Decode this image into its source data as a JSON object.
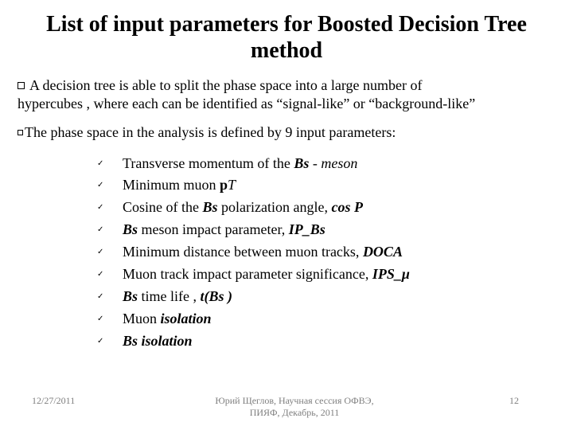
{
  "title": "List of input parameters for Boosted Decision Tree method",
  "para1_a": "A  decision tree is able to split the phase space into a large number of",
  "para1_b": "hypercubes ,  where each can be  identified as “signal-like” or “background-like”",
  "para2": "The phase space in the analysis is defined by 9 input parameters:",
  "items": [
    {
      "t0": "Transverse momentum  of the ",
      "bi0": "Bs",
      "t1": " - ",
      "i1": "meson"
    },
    {
      "t0": "Minimum   muon ",
      "b0": "p",
      "i1": "T"
    },
    {
      "t0": "Cosine of the ",
      "bi0": "Bs",
      "t1": "  polarization angle, ",
      "bi1": "cos P"
    },
    {
      "bi0": "Bs",
      "t1": "  meson impact parameter,  ",
      "bi1": "IP_Bs"
    },
    {
      "t0": "Minimum distance between muon tracks,  ",
      "bi0": "DOCA"
    },
    {
      "t0": "Muon track impact parameter significance, ",
      "bi0": "IPS_μ"
    },
    {
      "bi0": "Bs",
      "t1": "  time life , ",
      "bi1": "t(Bs )"
    },
    {
      "t0": "Muon  ",
      "bi0": "isolation"
    },
    {
      "bi0": "Bs  isolation"
    }
  ],
  "footer": {
    "date": "12/27/2011",
    "center1": "Юрий Щеглов, Научная сессия ОФВЭ,",
    "center2": "ПИЯФ, Декабрь, 2011",
    "page": "12"
  },
  "check": "✓"
}
